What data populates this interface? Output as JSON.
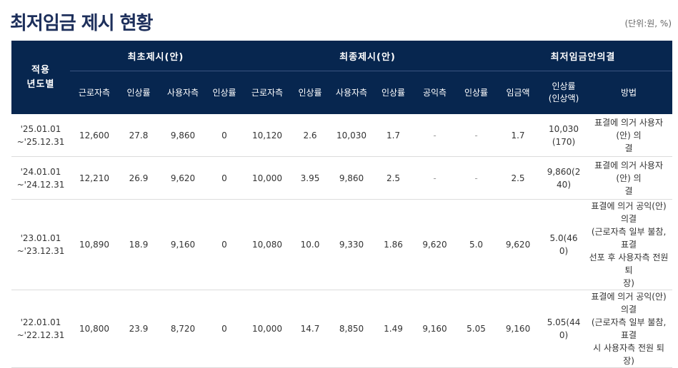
{
  "title": "최저임금 제시 현황",
  "unit": "(단위:원, %)",
  "header": {
    "period": [
      "적용",
      "년도별"
    ],
    "group_initial": "최초제시(안)",
    "group_final": "최종제시(안)",
    "group_decision": "최저임금안의결",
    "cols": {
      "labor": "근로자측",
      "rate": "인상률",
      "employer": "사용자측",
      "public": "공익측",
      "wage": "임금액",
      "rate_amount": [
        "인상률",
        "(인상액)"
      ],
      "method": "방법"
    }
  },
  "rows": [
    {
      "period": [
        "'25.01.01",
        "~'25.12.31"
      ],
      "init_labor": "12,600",
      "init_labor_rate": "27.8",
      "init_emp": "9,860",
      "init_emp_rate": "0",
      "final_labor": "10,120",
      "final_labor_rate": "2.6",
      "final_emp": "10,030",
      "final_emp_rate": "1.7",
      "final_pub": "-",
      "final_pub_rate": "-",
      "wage": "1.7",
      "rate_amount": [
        "10,030",
        "(170)"
      ],
      "method": [
        "표결에 의거 사용자(안) 의",
        "결"
      ]
    },
    {
      "period": [
        "'24.01.01",
        "~'24.12.31"
      ],
      "init_labor": "12,210",
      "init_labor_rate": "26.9",
      "init_emp": "9,620",
      "init_emp_rate": "0",
      "final_labor": "10,000",
      "final_labor_rate": "3.95",
      "final_emp": "9,860",
      "final_emp_rate": "2.5",
      "final_pub": "-",
      "final_pub_rate": "-",
      "wage": "2.5",
      "rate_amount": [
        "9,860(2",
        "40)"
      ],
      "method": [
        "표결에 의거 사용자(안) 의",
        "결"
      ]
    },
    {
      "period": [
        "'23.01.01",
        "~'23.12.31"
      ],
      "init_labor": "10,890",
      "init_labor_rate": "18.9",
      "init_emp": "9,160",
      "init_emp_rate": "0",
      "final_labor": "10,080",
      "final_labor_rate": "10.0",
      "final_emp": "9,330",
      "final_emp_rate": "1.86",
      "final_pub": "9,620",
      "final_pub_rate": "5.0",
      "wage": "9,620",
      "rate_amount": [
        "5.0(46",
        "0)"
      ],
      "method": [
        "표결에 의거 공익(안) 의결",
        "(근로자측 일부 불참, 표결",
        "선포 후 사용자측 전원 퇴",
        "장)"
      ]
    },
    {
      "period": [
        "'22.01.01",
        "~'22.12.31"
      ],
      "init_labor": "10,800",
      "init_labor_rate": "23.9",
      "init_emp": "8,720",
      "init_emp_rate": "0",
      "final_labor": "10,000",
      "final_labor_rate": "14.7",
      "final_emp": "8,850",
      "final_emp_rate": "1.49",
      "final_pub": "9,160",
      "final_pub_rate": "5.05",
      "wage": "9,160",
      "rate_amount": [
        "5.05(44",
        "0)"
      ],
      "method": [
        "표결에 의거 공익(안) 의결",
        "(근로자측 일부 불참, 표결",
        "시 사용자측 전원 퇴장)"
      ]
    }
  ]
}
